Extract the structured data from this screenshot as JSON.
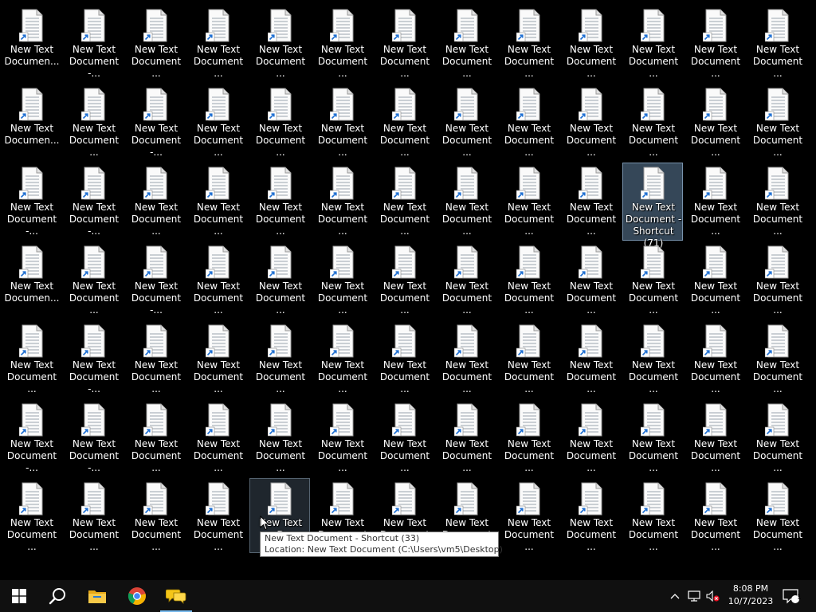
{
  "desktop": {
    "icon_rows": [
      [
        "New Text\nDocumen...",
        "New Text\nDocument -...",
        "New Text\nDocument ...",
        "New Text\nDocument ...",
        "New Text\nDocument ...",
        "New Text\nDocument ...",
        "New Text\nDocument ...",
        "New Text\nDocument ...",
        "New Text\nDocument ...",
        "New Text\nDocument ...",
        "New Text\nDocument ...",
        "New Text\nDocument ...",
        "New Text\nDocument ..."
      ],
      [
        "New Text\nDocumen...",
        "New Text\nDocument ...",
        "New Text\nDocument -...",
        "New Text\nDocument ...",
        "New Text\nDocument ...",
        "New Text\nDocument ...",
        "New Text\nDocument ...",
        "New Text\nDocument ...",
        "New Text\nDocument ...",
        "New Text\nDocument ...",
        "New Text\nDocument ...",
        "New Text\nDocument ...",
        "New Text\nDocument ..."
      ],
      [
        "New Text\nDocument -...",
        "New Text\nDocument -...",
        "New Text\nDocument ...",
        "New Text\nDocument ...",
        "New Text\nDocument ...",
        "New Text\nDocument ...",
        "New Text\nDocument ...",
        "New Text\nDocument ...",
        "New Text\nDocument ...",
        "New Text\nDocument ...",
        "New Text\nDocument -\nShortcut (71)",
        "New Text\nDocument ...",
        "New Text\nDocument ..."
      ],
      [
        "New Text\nDocumen...",
        "New Text\nDocument ...",
        "New Text\nDocument -...",
        "New Text\nDocument ...",
        "New Text\nDocument ...",
        "New Text\nDocument ...",
        "New Text\nDocument ...",
        "New Text\nDocument ...",
        "New Text\nDocument ...",
        "New Text\nDocument ...",
        "New Text\nDocument ...",
        "New Text\nDocument ...",
        "New Text\nDocument ..."
      ],
      [
        "New Text\nDocument ...",
        "New Text\nDocument -...",
        "New Text\nDocument ...",
        "New Text\nDocument ...",
        "New Text\nDocument ...",
        "New Text\nDocument ...",
        "New Text\nDocument ...",
        "New Text\nDocument ...",
        "New Text\nDocument ...",
        "New Text\nDocument ...",
        "New Text\nDocument ...",
        "New Text\nDocument ...",
        "New Text\nDocument ..."
      ],
      [
        "New Text\nDocument -...",
        "New Text\nDocument -...",
        "New Text\nDocument ...",
        "New Text\nDocument ...",
        "New Text\nDocument ...",
        "New Text\nDocument ...",
        "New Text\nDocument ...",
        "New Text\nDocument ...",
        "New Text\nDocument ...",
        "New Text\nDocument ...",
        "New Text\nDocument ...",
        "New Text\nDocument ...",
        "New Text\nDocument ..."
      ],
      [
        "New Text\nDocument ...",
        "New Text\nDocument ...",
        "New Text\nDocument ...",
        "New Text\nDocument ...",
        "New Text\nD",
        "New Text\nDocument ...",
        "New Text\nDocument ...",
        "New Text\nDocument ...",
        "New Text\nDocument ...",
        "New Text\nDocument ...",
        "New Text\nDocument ...",
        "New Text\nDocument ...",
        "New Text\nDocument ..."
      ]
    ],
    "selected_icon": {
      "row": 2,
      "col": 10
    },
    "hovered_icon": {
      "row": 6,
      "col": 4
    },
    "icon_name": "text-document-shortcut-icon"
  },
  "tooltip": {
    "line1": "New Text Document - Shortcut (33)",
    "line2": "Location: New Text Document (C:\\Users\\vm5\\Desktop)"
  },
  "taskbar": {
    "items": [
      {
        "name": "start-button",
        "icon": "windows-logo-icon"
      },
      {
        "name": "search-button",
        "icon": "search-icon"
      },
      {
        "name": "file-explorer-button",
        "icon": "folder-icon"
      },
      {
        "name": "chrome-button",
        "icon": "chrome-icon"
      },
      {
        "name": "app-button",
        "icon": "chat-bubbles-icon",
        "active": true
      }
    ],
    "tray": {
      "time": "8:08 PM",
      "date": "10/7/2023",
      "notification_count": "1"
    }
  },
  "colors": {
    "desktop_bg": "#000000",
    "taskbar_bg": "#101010",
    "selection": "#5f8299",
    "accent": "#76b9ed"
  }
}
